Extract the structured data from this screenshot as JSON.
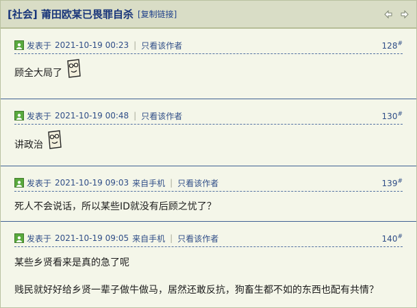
{
  "thread": {
    "title": "[社会] 莆田欧某已畏罪自杀",
    "copy_link": "[复制链接]",
    "nav_prev_icon": "arrow-left-icon",
    "nav_next_icon": "arrow-right-icon"
  },
  "posts": [
    {
      "prefix": "发表于",
      "datetime": "2021-10-19 00:23",
      "source": "",
      "only_author": "只看该作者",
      "floor": "128",
      "floor_mark": "#",
      "lines": [
        "顾全大局了"
      ],
      "emoticon": "smiley-glasses-icon"
    },
    {
      "prefix": "发表于",
      "datetime": "2021-10-19 00:48",
      "source": "",
      "only_author": "只看该作者",
      "floor": "130",
      "floor_mark": "#",
      "lines": [
        "讲政治"
      ],
      "emoticon": "smiley-glasses-icon"
    },
    {
      "prefix": "发表于",
      "datetime": "2021-10-19 09:03",
      "source": "来自手机",
      "only_author": "只看该作者",
      "floor": "139",
      "floor_mark": "#",
      "lines": [
        "死人不会说话，所以某些ID就没有后顾之忧了？"
      ],
      "emoticon": ""
    },
    {
      "prefix": "发表于",
      "datetime": "2021-10-19 09:05",
      "source": "来自手机",
      "only_author": "只看该作者",
      "floor": "140",
      "floor_mark": "#",
      "lines": [
        "某些乡贤看来是真的急了呢",
        "贱民就好好给乡贤一辈子做牛做马，居然还敢反抗，狗畜生都不如的东西也配有共情？"
      ],
      "emoticon": ""
    }
  ]
}
